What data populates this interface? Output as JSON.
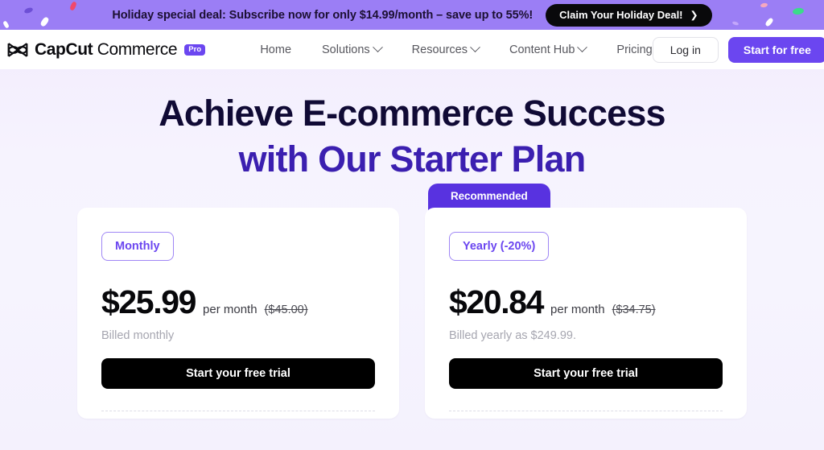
{
  "promo": {
    "text": "Holiday special deal: Subscribe now for only $14.99/month – save up to 55%!",
    "cta_label": "Claim Your Holiday Deal!",
    "cta_chevron": "chevron-right-icon",
    "background_color": "#9b7ef5",
    "cta_background_color": "#09090b"
  },
  "nav": {
    "brand": {
      "mark": "capcut-logo-icon",
      "name_bold": "CapCut",
      "name_light": " Commerce",
      "badge": "Pro",
      "badge_color": "#6b46f0"
    },
    "links": [
      {
        "label": "Home",
        "has_caret": false
      },
      {
        "label": "Solutions",
        "has_caret": true
      },
      {
        "label": "Resources",
        "has_caret": true
      },
      {
        "label": "Content Hub",
        "has_caret": true
      },
      {
        "label": "Pricing",
        "has_caret": false
      }
    ],
    "login_label": "Log in",
    "start_label": "Start for free",
    "start_color": "#6b46f0"
  },
  "hero": {
    "line1": "Achieve E-commerce Success",
    "line2": "with Our Starter Plan",
    "line1_color": "#100a35",
    "line2_color": "#3b1fb0"
  },
  "pricing": {
    "recommended_label": "Recommended",
    "recommended_color": "#5832e0",
    "plans": [
      {
        "term_label": "Monthly",
        "price": "$25.99",
        "unit": "per month",
        "old_price": "($45.00)",
        "billed_note": "Billed monthly",
        "cta_label": "Start your free trial",
        "recommended": false
      },
      {
        "term_label": "Yearly (-20%)",
        "price": "$20.84",
        "unit": "per month",
        "old_price": "($34.75)",
        "billed_note": "Billed yearly as $249.99.",
        "cta_label": "Start your free trial",
        "recommended": true
      }
    ]
  }
}
